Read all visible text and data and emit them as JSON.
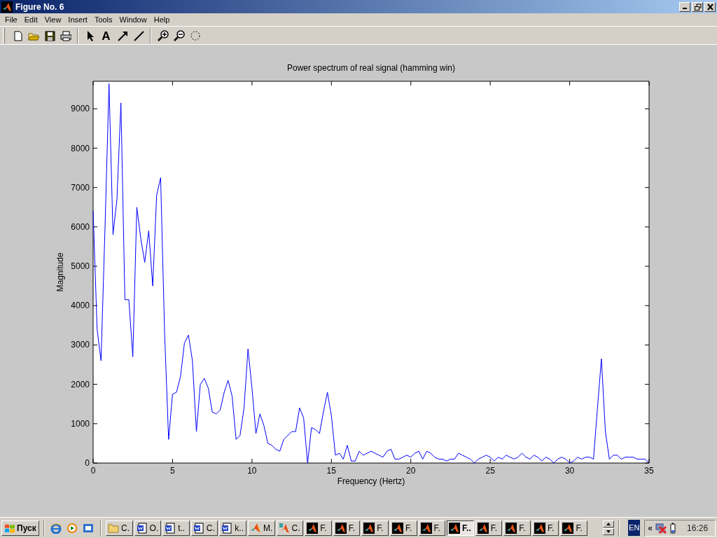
{
  "window": {
    "title": "Figure No. 6"
  },
  "menu": [
    "File",
    "Edit",
    "View",
    "Insert",
    "Tools",
    "Window",
    "Help"
  ],
  "toolbar": [
    {
      "kind": "new"
    },
    {
      "kind": "open"
    },
    {
      "kind": "save"
    },
    {
      "kind": "print"
    },
    {
      "kind": "sep"
    },
    {
      "kind": "pointer"
    },
    {
      "kind": "text",
      "label": "A"
    },
    {
      "kind": "arrow"
    },
    {
      "kind": "line"
    },
    {
      "kind": "sep"
    },
    {
      "kind": "zoom-in"
    },
    {
      "kind": "zoom-out"
    },
    {
      "kind": "rotate"
    }
  ],
  "figure": {
    "chart_data": {
      "type": "line",
      "title": "Power spectrum of real signal (hamming win)",
      "xlabel": "Frequency (Hertz)",
      "ylabel": "Magnitude",
      "xlim": [
        0,
        35
      ],
      "ylim": [
        0,
        9700
      ],
      "xticks": [
        0,
        5,
        10,
        15,
        20,
        25,
        30,
        35
      ],
      "yticks": [
        0,
        1000,
        2000,
        3000,
        4000,
        5000,
        6000,
        7000,
        8000,
        9000
      ],
      "x": [
        0,
        0.25,
        0.5,
        0.75,
        1,
        1.25,
        1.5,
        1.75,
        2,
        2.25,
        2.5,
        2.75,
        3,
        3.25,
        3.5,
        3.75,
        4,
        4.25,
        4.5,
        4.75,
        5,
        5.25,
        5.5,
        5.75,
        6,
        6.25,
        6.5,
        6.75,
        7,
        7.25,
        7.5,
        7.75,
        8,
        8.25,
        8.5,
        8.75,
        9,
        9.25,
        9.5,
        9.75,
        10,
        10.25,
        10.5,
        10.75,
        11,
        11.25,
        11.5,
        11.75,
        12,
        12.25,
        12.5,
        12.75,
        13,
        13.25,
        13.5,
        13.75,
        14,
        14.25,
        14.5,
        14.75,
        15,
        15.25,
        15.5,
        15.75,
        16,
        16.25,
        16.5,
        16.75,
        17,
        17.25,
        17.5,
        17.75,
        18,
        18.25,
        18.5,
        18.75,
        19,
        19.25,
        19.5,
        19.75,
        20,
        20.25,
        20.5,
        20.75,
        21,
        21.25,
        21.5,
        21.75,
        22,
        22.25,
        22.5,
        22.75,
        23,
        23.25,
        23.5,
        23.75,
        24,
        24.25,
        24.5,
        24.75,
        25,
        25.25,
        25.5,
        25.75,
        26,
        26.25,
        26.5,
        26.75,
        27,
        27.25,
        27.5,
        27.75,
        28,
        28.25,
        28.5,
        28.75,
        29,
        29.25,
        29.5,
        29.75,
        30,
        30.25,
        30.5,
        30.75,
        31,
        31.25,
        31.5,
        31.75,
        32,
        32.25,
        32.5,
        32.75,
        33,
        33.25,
        33.5,
        33.75,
        34,
        34.25,
        34.5,
        34.75,
        35
      ],
      "series": [
        {
          "color": "#0000ff",
          "values": [
            6400,
            3400,
            2600,
            6000,
            9640,
            5800,
            6700,
            9150,
            4150,
            4150,
            2700,
            6500,
            5700,
            5100,
            5900,
            4500,
            6800,
            7250,
            3300,
            600,
            1750,
            1800,
            2200,
            3050,
            3250,
            2600,
            800,
            2000,
            2150,
            1900,
            1300,
            1250,
            1350,
            1800,
            2100,
            1700,
            600,
            700,
            1400,
            2900,
            1900,
            750,
            1250,
            950,
            500,
            450,
            350,
            300,
            600,
            700,
            800,
            800,
            1400,
            1150,
            0,
            900,
            850,
            750,
            1300,
            1800,
            1200,
            200,
            250,
            100,
            450,
            50,
            50,
            300,
            200,
            250,
            300,
            250,
            200,
            150,
            300,
            350,
            100,
            100,
            150,
            200,
            150,
            250,
            300,
            100,
            300,
            250,
            150,
            100,
            100,
            50,
            100,
            100,
            250,
            200,
            150,
            100,
            0,
            100,
            150,
            200,
            150,
            50,
            150,
            100,
            200,
            150,
            100,
            150,
            250,
            150,
            100,
            200,
            150,
            50,
            150,
            100,
            0,
            100,
            150,
            100,
            0,
            50,
            150,
            100,
            150,
            150,
            100,
            1400,
            2650,
            800,
            100,
            200,
            200,
            100,
            150,
            150,
            150,
            100,
            100,
            100,
            0
          ]
        }
      ]
    }
  },
  "taskbar": {
    "start": "Пуск",
    "quick_launch": [
      {
        "kind": "browser"
      },
      {
        "kind": "media"
      },
      {
        "kind": "outlook"
      }
    ],
    "tasks": [
      {
        "kind": "folder",
        "label": "C.",
        "selected": false
      },
      {
        "kind": "word",
        "label": "O.",
        "selected": false
      },
      {
        "kind": "word",
        "label": "t..",
        "selected": false
      },
      {
        "kind": "word",
        "label": "C.",
        "selected": false
      },
      {
        "kind": "word",
        "label": "k..",
        "selected": false
      },
      {
        "kind": "matlab",
        "label": "M.",
        "selected": false
      },
      {
        "kind": "matlab-tool",
        "label": "C.",
        "selected": false
      },
      {
        "kind": "figure",
        "label": "F.",
        "selected": false
      },
      {
        "kind": "figure",
        "label": "F.",
        "selected": false
      },
      {
        "kind": "figure",
        "label": "F.",
        "selected": false
      },
      {
        "kind": "figure",
        "label": "F.",
        "selected": false
      },
      {
        "kind": "figure",
        "label": "F.",
        "selected": false
      },
      {
        "kind": "figure",
        "label": "F..",
        "selected": true
      },
      {
        "kind": "figure",
        "label": "F.",
        "selected": false
      },
      {
        "kind": "figure",
        "label": "F.",
        "selected": false
      },
      {
        "kind": "figure",
        "label": "F.",
        "selected": false
      },
      {
        "kind": "figure",
        "label": "F.",
        "selected": false
      }
    ],
    "language": "EN",
    "tray_expand": "«",
    "clock": "16:26"
  }
}
